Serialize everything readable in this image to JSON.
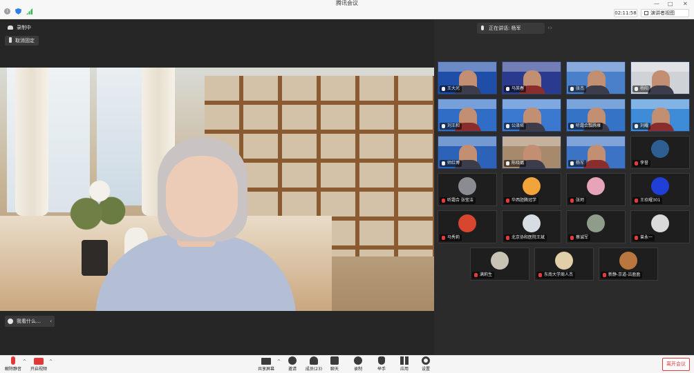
{
  "titlebar": {
    "title": "腾讯会议",
    "timer": "02:11:58",
    "view_label": "演讲者视图",
    "min_symbol": "—",
    "max_symbol": "□",
    "close_symbol": "✕"
  },
  "stage": {
    "recording_label": "录制中",
    "unpin_label": "取消固定",
    "status_text": "我看什么…",
    "collapse_symbol": "‹"
  },
  "side": {
    "speaking_label": "正在讲话: 杨军",
    "pager_symbol": "‹›",
    "participants": [
      {
        "name": "王大光",
        "kind": "video",
        "muted": false,
        "bg": "#1e4ea8"
      },
      {
        "name": "马英春",
        "kind": "video",
        "muted": false,
        "bg": "#2a3a8f"
      },
      {
        "name": "张杰",
        "kind": "video",
        "muted": false,
        "bg": "#4a7fc9"
      },
      {
        "name": "杨阳",
        "kind": "video",
        "muted": false,
        "bg": "#cfd3d8"
      },
      {
        "name": "刘王和",
        "kind": "video",
        "muted": false,
        "bg": "#2f6dc7"
      },
      {
        "name": "公泽培",
        "kind": "video",
        "muted": false,
        "bg": "#3b78cf"
      },
      {
        "name": "听霜合瓢腾雁",
        "kind": "video",
        "muted": false,
        "bg": "#3573c6"
      },
      {
        "name": "刘耀",
        "kind": "video",
        "muted": false,
        "bg": "#3e8bd8"
      },
      {
        "name": "师红博",
        "kind": "video",
        "muted": false,
        "bg": "#2c63b8"
      },
      {
        "name": "陈晓璐",
        "kind": "video",
        "muted": false,
        "bg": "#a7896b"
      },
      {
        "name": "杨军",
        "kind": "video",
        "muted": false,
        "bg": "#3c73c4"
      },
      {
        "name": "李誉",
        "kind": "avatar",
        "muted": true,
        "bg": "#2d5f93"
      },
      {
        "name": "听霜合 张莹洁",
        "kind": "avatar",
        "muted": true,
        "bg": "#8a8c92"
      },
      {
        "name": "华西胆腾冠学",
        "kind": "avatar",
        "muted": true,
        "bg": "#f0a43a"
      },
      {
        "name": "张珂",
        "kind": "avatar",
        "muted": true,
        "bg": "#e7a3b8"
      },
      {
        "name": "王玖曜301",
        "kind": "avatar",
        "muted": true,
        "bg": "#1f3fd6"
      },
      {
        "name": "马秀莉",
        "kind": "avatar",
        "muted": true,
        "bg": "#d9462f"
      },
      {
        "name": "北京协和医院王斌",
        "kind": "avatar",
        "muted": true,
        "bg": "#d8dde3"
      },
      {
        "name": "蔡诚军",
        "kind": "avatar",
        "muted": true,
        "bg": "#8f9c8a"
      },
      {
        "name": "曾永一",
        "kind": "avatar",
        "muted": true,
        "bg": "#d9d9d9"
      },
      {
        "name": "满莉生",
        "kind": "avatar",
        "muted": true,
        "bg": "#c9c3b5"
      },
      {
        "name": "东南大学周人杰",
        "kind": "avatar",
        "muted": true,
        "bg": "#e0cfa8"
      },
      {
        "name": "新静-京道-吕盈盈",
        "kind": "avatar",
        "muted": true,
        "bg": "#b9763f"
      }
    ]
  },
  "toolbar": {
    "unmute": "解除静音",
    "start_video": "开启视频",
    "share": "共享屏幕",
    "invite": "邀请",
    "members": "成员(23)",
    "chat": "聊天",
    "record": "录制",
    "reactions": "举手",
    "apps": "应用",
    "settings": "设置",
    "leave": "离开会议",
    "caret": "^"
  }
}
